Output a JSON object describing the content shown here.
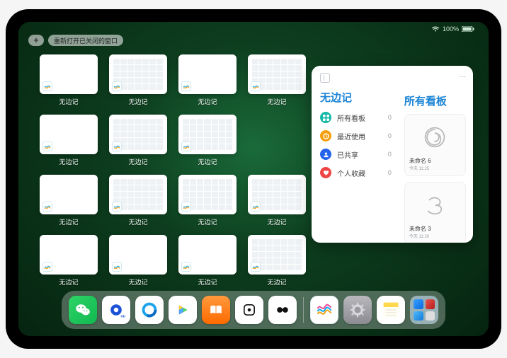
{
  "status": {
    "battery": "100%"
  },
  "top": {
    "add": "+",
    "reopen": "重新打开已关闭的窗口"
  },
  "apps": {
    "label": "无边记"
  },
  "panel": {
    "title_left": "无边记",
    "title_right": "所有看板",
    "ellipsis": "···",
    "items": [
      {
        "label": "所有看板",
        "count": "0"
      },
      {
        "label": "最近使用",
        "count": "0"
      },
      {
        "label": "已共享",
        "count": "0"
      },
      {
        "label": "个人收藏",
        "count": "0"
      }
    ],
    "boards": [
      {
        "name": "未命名 6",
        "time": "今天 11:25"
      },
      {
        "name": "未命名 3",
        "time": "今天 11:20"
      }
    ]
  },
  "dock": {
    "icons": [
      "wechat",
      "qbrowser-hd",
      "qbrowser",
      "play-media",
      "books",
      "dice",
      "huawei-health",
      "freeform",
      "settings",
      "notes"
    ],
    "folder": [
      "safari",
      "appstore",
      "files",
      "misc"
    ]
  }
}
